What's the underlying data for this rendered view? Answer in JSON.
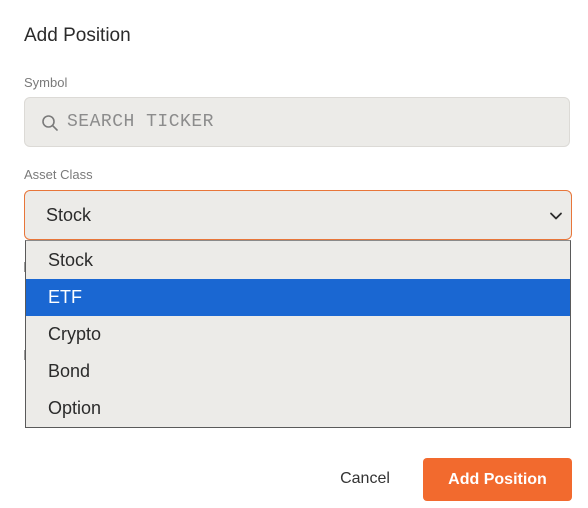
{
  "dialog": {
    "title": "Add Position"
  },
  "symbol": {
    "label": "Symbol",
    "placeholder": "SEARCH TICKER",
    "value": ""
  },
  "asset_class": {
    "label": "Asset Class",
    "selected": "Stock",
    "options": [
      "Stock",
      "ETF",
      "Crypto",
      "Bond",
      "Option"
    ],
    "highlighted_option": "ETF"
  },
  "actions": {
    "cancel_label": "Cancel",
    "submit_label": "Add Position"
  },
  "colors": {
    "accent": "#f26a2e",
    "highlight": "#1a67d2",
    "field_bg": "#ecebe8"
  },
  "icons": {
    "search": "search-icon",
    "chevron": "chevron-down-icon"
  }
}
